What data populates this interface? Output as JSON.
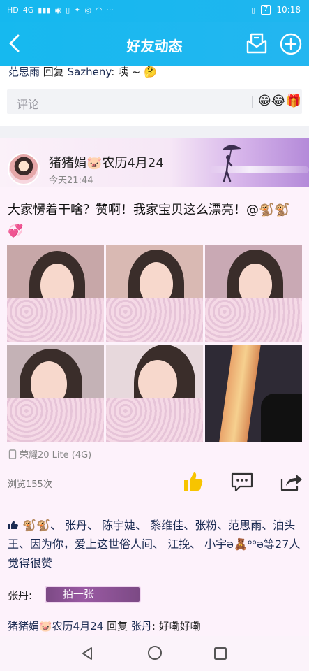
{
  "status_bar": {
    "left_glyphs": [
      "HD",
      "4G",
      "📶",
      "💬",
      "🔋",
      "✦",
      "📷",
      "📶",
      "···"
    ],
    "battery": "7",
    "time": "10:18"
  },
  "nav": {
    "title": "好友动态"
  },
  "previous_reply": {
    "name": "范思雨",
    "verb": " 回复 ",
    "target": "Sazheny",
    "text": ": 咦 ~ 🤔"
  },
  "comment_bar": {
    "placeholder": "评论",
    "emojis": "😁😂🎁"
  },
  "post": {
    "author": "猪猪娟🐷农历4月24",
    "time": "今天21:44",
    "text": "大家愣着干啥？赞啊！我家宝贝这么漂亮！@🐒🐒 💞",
    "device": "荣耀20 Lite (4G)",
    "views": "浏览155次"
  },
  "likes": {
    "line": "🐒🐒、 张丹、 陈宇婕、 黎维佳、张粉、范思雨、油头王、因为你，爱上这世俗人间、 江挽、 小宇ə🧸ᵒᵒə等27人觉得很赞"
  },
  "comments": [
    {
      "name": "张丹:",
      "pat": "拍一张"
    }
  ],
  "reply": {
    "name": "猪猪娟🐷农历4月24",
    "verb": " 回复 ",
    "target": "张丹",
    "text": ": 好嘞好嘞"
  },
  "colors": {
    "header_blue": "#18b8ef",
    "card_pink": "#fdf2fb",
    "like_yellow": "#f7c400",
    "name_navy": "#1b2b52"
  }
}
